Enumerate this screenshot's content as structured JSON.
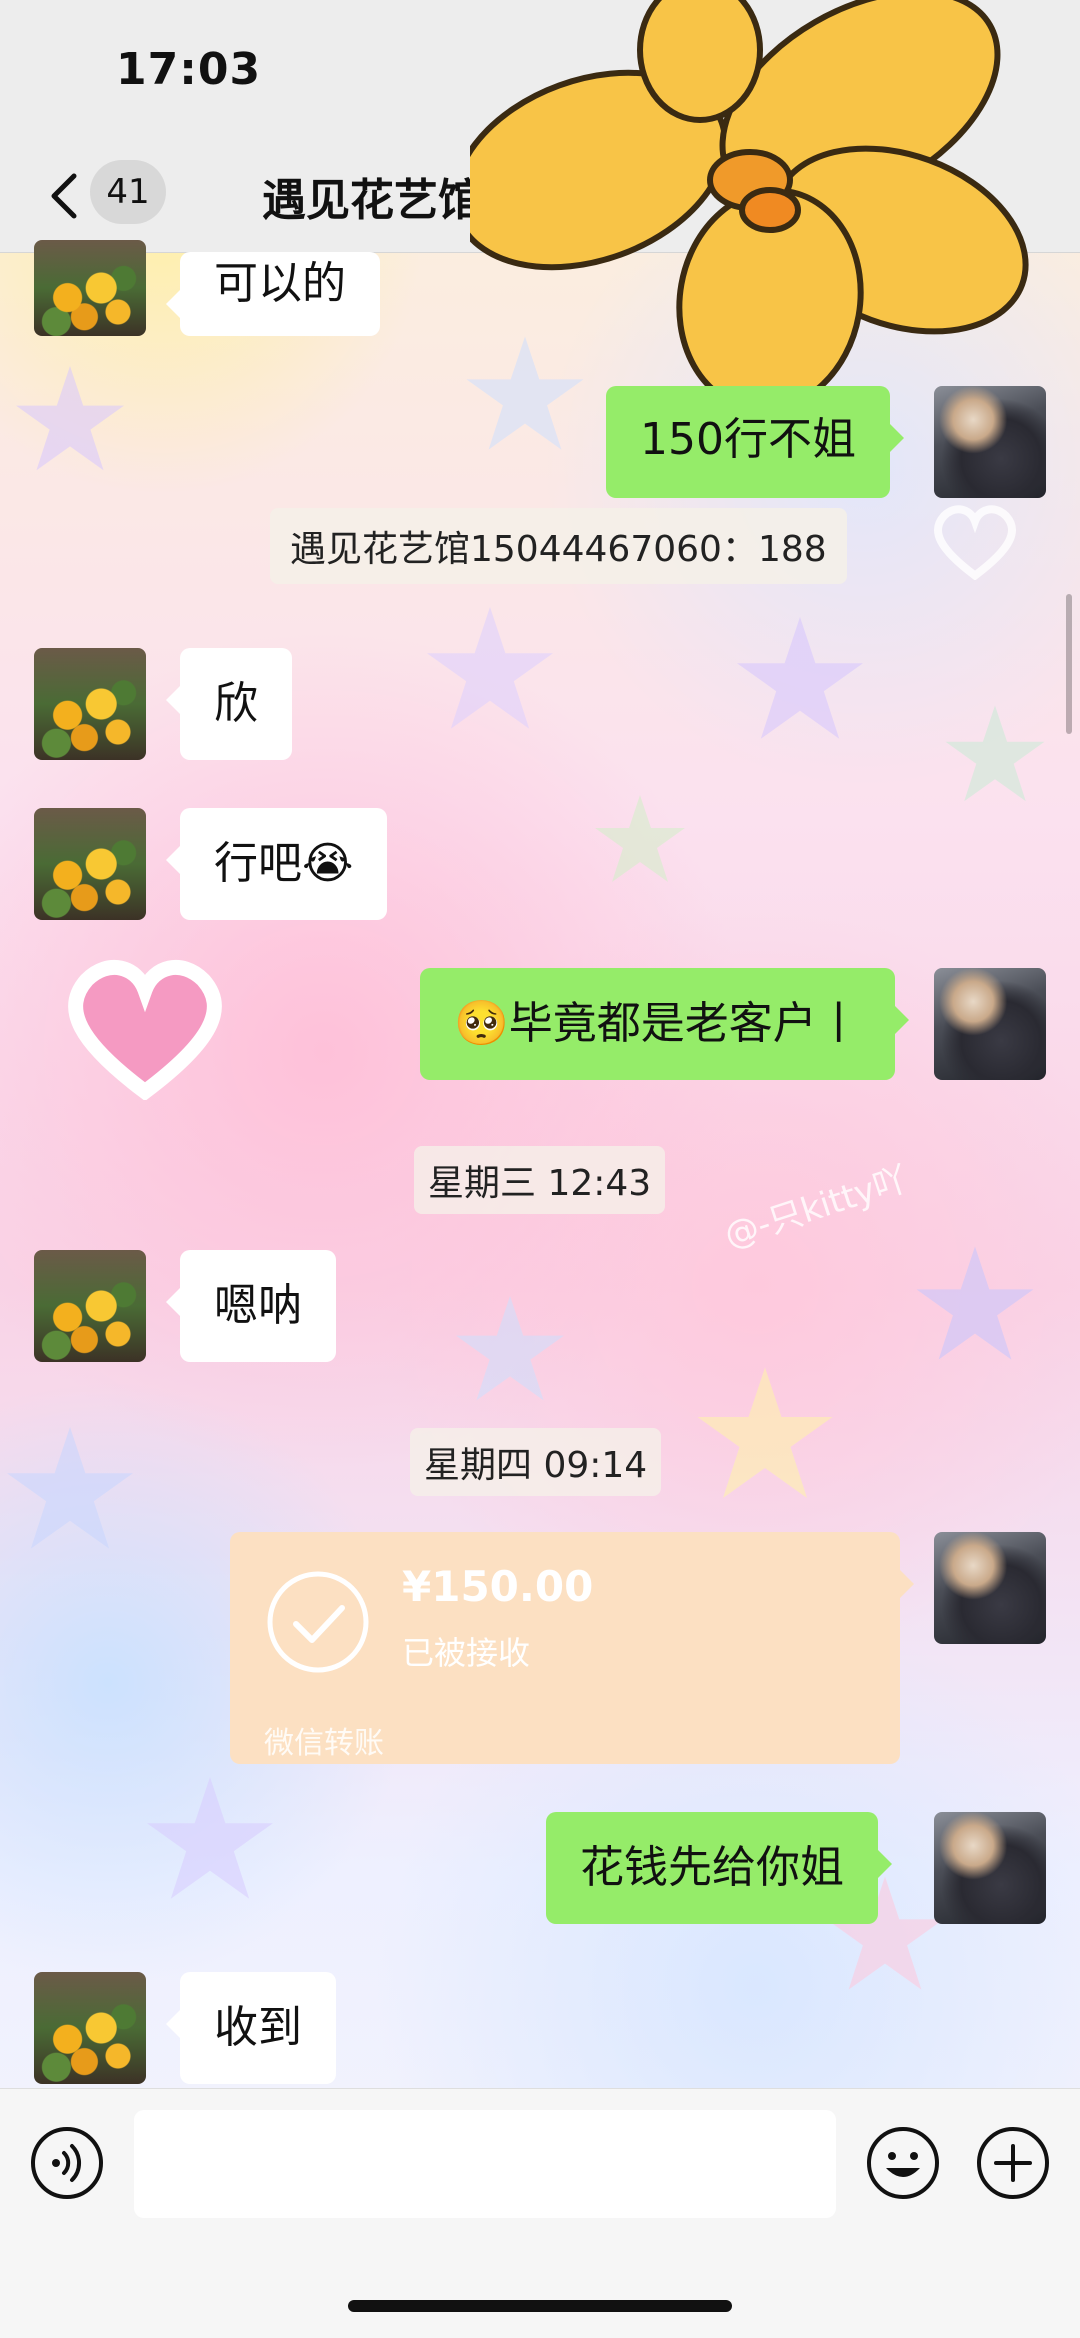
{
  "status_bar": {
    "time": "17:03"
  },
  "header": {
    "unread_count": "41",
    "title": "遇见花艺馆"
  },
  "watermark": "@-只kitty吖",
  "messages": [
    {
      "side": "in",
      "text": "可以的"
    },
    {
      "side": "out",
      "text": "150行不姐"
    },
    {
      "type": "system",
      "text": "遇见花艺馆15044467060：188"
    },
    {
      "side": "in",
      "text": "欣"
    },
    {
      "side": "in",
      "text": "行吧😭"
    },
    {
      "side": "out",
      "text": "🥺毕竟都是老客户丨"
    },
    {
      "type": "timestamp",
      "text": "星期三 12:43"
    },
    {
      "side": "in",
      "text": "嗯呐"
    },
    {
      "type": "timestamp",
      "text": "星期四 09:14"
    },
    {
      "side": "out",
      "type": "transfer",
      "amount": "¥150.00",
      "status": "已被接收",
      "footer": "微信转账"
    },
    {
      "side": "out",
      "text": "花钱先给你姐"
    },
    {
      "side": "in",
      "text": "收到"
    }
  ],
  "input": {
    "value": "",
    "placeholder": ""
  },
  "colors": {
    "outgoing_bubble": "#95ec69",
    "incoming_bubble": "#ffffff",
    "transfer_card": "#fce0c2",
    "bar": "#ededed"
  }
}
